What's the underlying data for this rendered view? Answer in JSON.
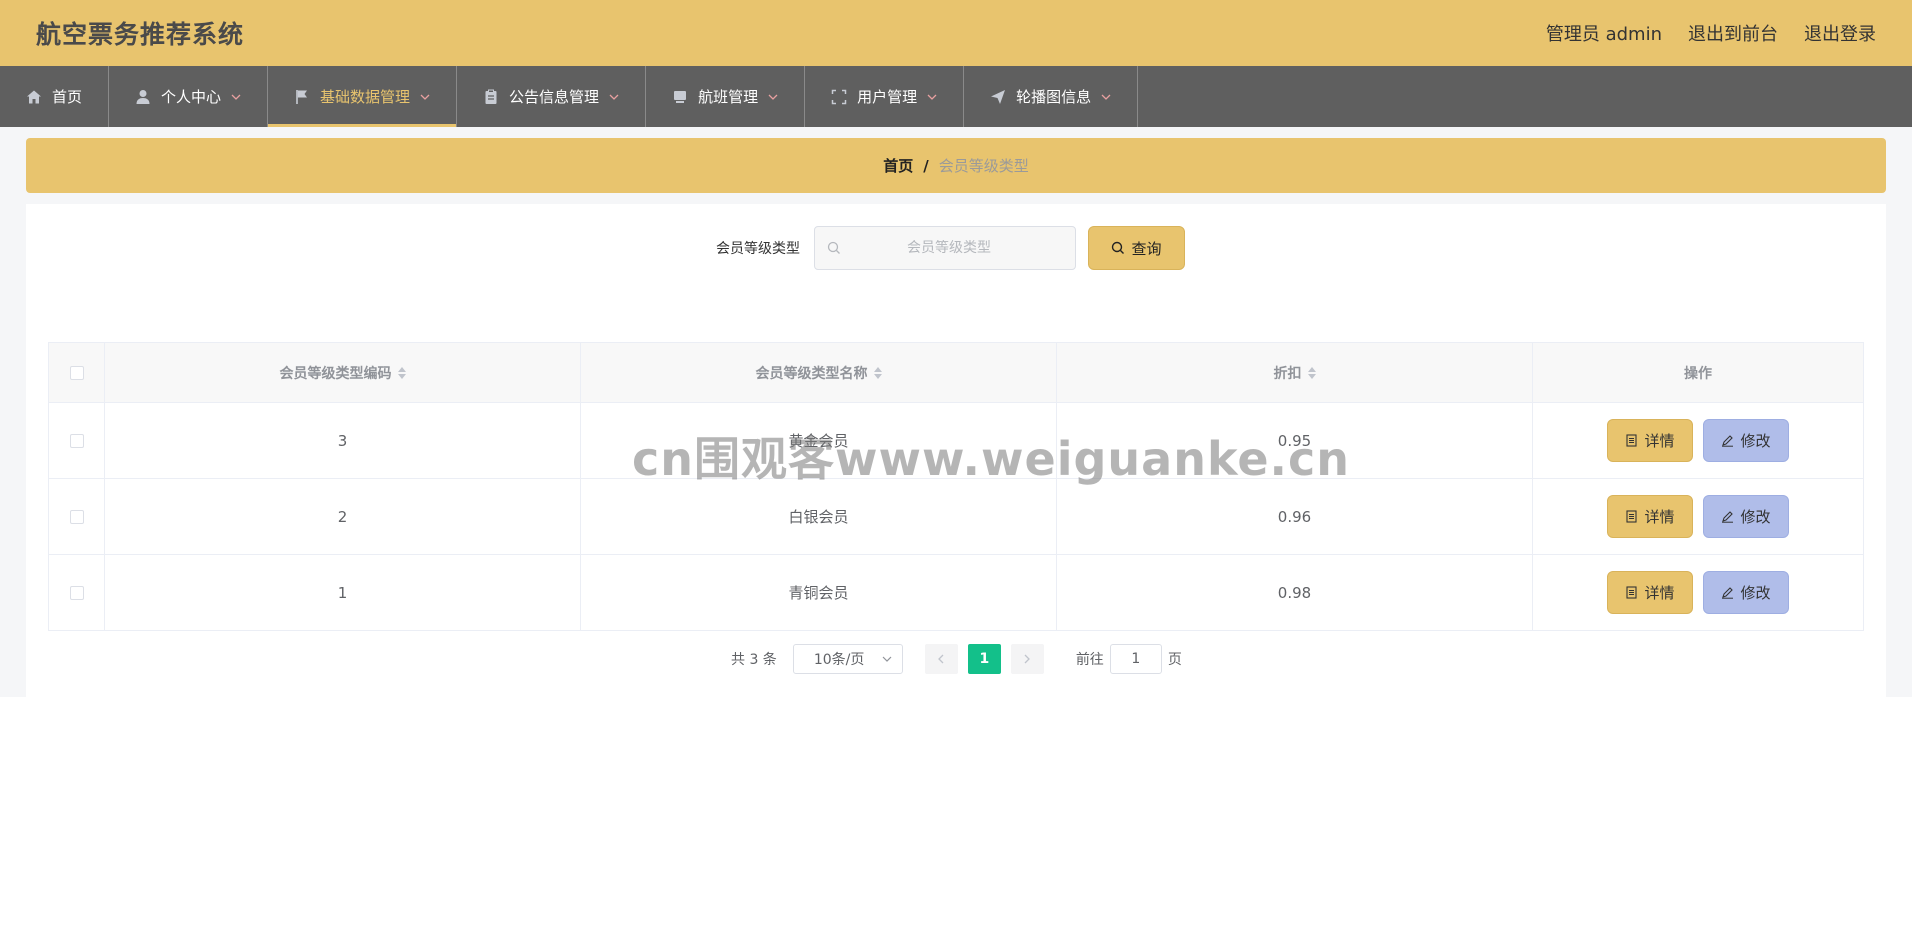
{
  "header": {
    "title": "航空票务推荐系统",
    "admin_label": "管理员 admin",
    "front_link": "退出到前台",
    "logout_link": "退出登录"
  },
  "nav": {
    "items": [
      {
        "label": "首页",
        "icon": "home-icon"
      },
      {
        "label": "个人中心",
        "icon": "user-icon"
      },
      {
        "label": "基础数据管理",
        "icon": "flag-icon",
        "active": true
      },
      {
        "label": "公告信息管理",
        "icon": "clipboard-icon"
      },
      {
        "label": "航班管理",
        "icon": "monitor-icon"
      },
      {
        "label": "用户管理",
        "icon": "fullscreen-icon"
      },
      {
        "label": "轮播图信息",
        "icon": "send-icon"
      }
    ]
  },
  "breadcrumb": {
    "home": "首页",
    "separator": "/",
    "current": "会员等级类型"
  },
  "search": {
    "label": "会员等级类型",
    "placeholder": "会员等级类型",
    "value": "",
    "button_label": "查询"
  },
  "table": {
    "columns": [
      "会员等级类型编码",
      "会员等级类型名称",
      "折扣",
      "操作"
    ],
    "rows": [
      {
        "code": "3",
        "name": "黄金会员",
        "discount": "0.95"
      },
      {
        "code": "2",
        "name": "白银会员",
        "discount": "0.96"
      },
      {
        "code": "1",
        "name": "青铜会员",
        "discount": "0.98"
      }
    ],
    "detail_label": "详情",
    "edit_label": "修改"
  },
  "pagination": {
    "total_text": "共 3 条",
    "page_size": "10条/页",
    "current_page": "1",
    "goto_prefix": "前往",
    "goto_value": "1",
    "goto_suffix": "页"
  },
  "watermark": "cn围观客www.weiguanke.cn",
  "colors": {
    "accent": "#e8c46e",
    "nav_bg": "#5f5f5f",
    "edit_button": "#b0bde9",
    "page_active": "#13c08a"
  }
}
